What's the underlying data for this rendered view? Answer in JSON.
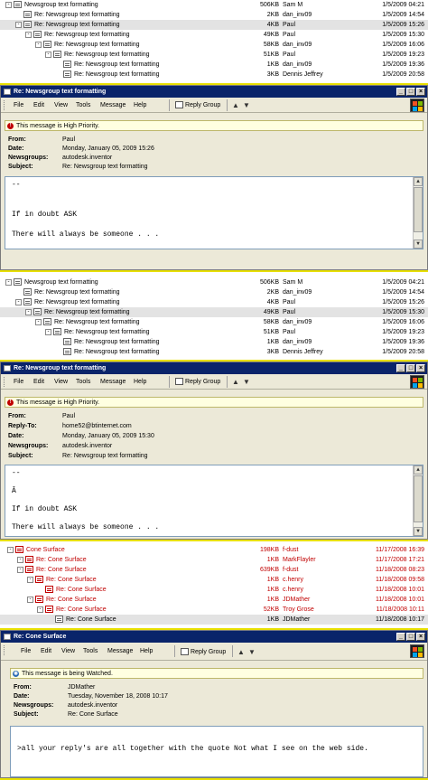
{
  "thread1": {
    "rows": [
      {
        "indent": 0,
        "subject": "Newsgroup text formatting",
        "size": "506KB",
        "from": "Sam M",
        "date": "1/5/2009 04:21",
        "exp": "-"
      },
      {
        "indent": 1,
        "subject": "Re: Newsgroup text formatting",
        "size": "2KB",
        "from": "dan_inv09",
        "date": "1/5/2009 14:54",
        "exp": ""
      },
      {
        "indent": 1,
        "subject": "Re: Newsgroup text formatting",
        "size": "4KB",
        "from": "Paul",
        "date": "1/5/2009 15:26",
        "exp": "-",
        "selected": true
      },
      {
        "indent": 2,
        "subject": "Re: Newsgroup text formatting",
        "size": "49KB",
        "from": "Paul",
        "date": "1/5/2009 15:30",
        "exp": "-"
      },
      {
        "indent": 3,
        "subject": "Re: Newsgroup text formatting",
        "size": "58KB",
        "from": "dan_inv09",
        "date": "1/5/2009 16:06",
        "exp": "-"
      },
      {
        "indent": 4,
        "subject": "Re: Newsgroup text formatting",
        "size": "51KB",
        "from": "Paul",
        "date": "1/5/2009 19:23",
        "exp": "-"
      },
      {
        "indent": 5,
        "subject": "Re: Newsgroup text formatting",
        "size": "1KB",
        "from": "dan_inv09",
        "date": "1/5/2009 19:36",
        "exp": ""
      },
      {
        "indent": 5,
        "subject": "Re: Newsgroup text formatting",
        "size": "3KB",
        "from": "Dennis Jeffrey",
        "date": "1/5/2009 20:58",
        "exp": ""
      }
    ]
  },
  "window1": {
    "title": "Re: Newsgroup text formatting",
    "menu": [
      "File",
      "Edit",
      "View",
      "Tools",
      "Message",
      "Help"
    ],
    "reply_group": "Reply Group",
    "banner": "This message is High Priority.",
    "headers": [
      {
        "k": "From:",
        "v": "Paul"
      },
      {
        "k": "Date:",
        "v": "Monday, January 05, 2009 15:26"
      },
      {
        "k": "Newsgroups:",
        "v": "autodesk.inventor"
      },
      {
        "k": "Subject:",
        "v": "Re: Newsgroup text formatting"
      }
    ],
    "body": [
      "--",
      "",
      "",
      "If in doubt ASK",
      "",
      "There will always be someone . . ."
    ]
  },
  "thread2": {
    "rows": [
      {
        "indent": 0,
        "subject": "Newsgroup text formatting",
        "size": "506KB",
        "from": "Sam M",
        "date": "1/5/2009 04:21",
        "exp": "-"
      },
      {
        "indent": 1,
        "subject": "Re: Newsgroup text formatting",
        "size": "2KB",
        "from": "dan_inv09",
        "date": "1/5/2009 14:54",
        "exp": ""
      },
      {
        "indent": 1,
        "subject": "Re: Newsgroup text formatting",
        "size": "4KB",
        "from": "Paul",
        "date": "1/5/2009 15:26",
        "exp": "-"
      },
      {
        "indent": 2,
        "subject": "Re: Newsgroup text formatting",
        "size": "49KB",
        "from": "Paul",
        "date": "1/5/2009 15:30",
        "exp": "-",
        "selected": true
      },
      {
        "indent": 3,
        "subject": "Re: Newsgroup text formatting",
        "size": "58KB",
        "from": "dan_inv09",
        "date": "1/5/2009 16:06",
        "exp": "-"
      },
      {
        "indent": 4,
        "subject": "Re: Newsgroup text formatting",
        "size": "51KB",
        "from": "Paul",
        "date": "1/5/2009 19:23",
        "exp": "-"
      },
      {
        "indent": 5,
        "subject": "Re: Newsgroup text formatting",
        "size": "1KB",
        "from": "dan_inv09",
        "date": "1/5/2009 19:36",
        "exp": ""
      },
      {
        "indent": 5,
        "subject": "Re: Newsgroup text formatting",
        "size": "3KB",
        "from": "Dennis Jeffrey",
        "date": "1/5/2009 20:58",
        "exp": ""
      }
    ]
  },
  "window2": {
    "title": "Re: Newsgroup text formatting",
    "menu": [
      "File",
      "Edit",
      "View",
      "Tools",
      "Message",
      "Help"
    ],
    "reply_group": "Reply Group",
    "banner": "This message is High Priority.",
    "headers": [
      {
        "k": "From:",
        "v": "Paul"
      },
      {
        "k": "Reply-To:",
        "v": "home52@btinternet.com"
      },
      {
        "k": "Date:",
        "v": "Monday, January 05, 2009 15:30"
      },
      {
        "k": "Newsgroups:",
        "v": "autodesk.inventor"
      },
      {
        "k": "Subject:",
        "v": "Re: Newsgroup text formatting"
      }
    ],
    "body": [
      "--",
      "",
      "Â",
      "",
      "If in doubt ASK",
      "",
      "There will always be someone . . ."
    ]
  },
  "thread3": {
    "rows": [
      {
        "indent": 0,
        "subject": "Cone Surface",
        "size": "198KB",
        "from": "f-dust",
        "date": "11/17/2008 16:39",
        "exp": "-"
      },
      {
        "indent": 1,
        "subject": "Re: Cone Surface",
        "size": "1KB",
        "from": "MarkFlayler",
        "date": "11/17/2008 17:21",
        "exp": "-"
      },
      {
        "indent": 1,
        "subject": "Re: Cone Surface",
        "size": "639KB",
        "from": "f-dust",
        "date": "11/18/2008 08:23",
        "exp": "-"
      },
      {
        "indent": 2,
        "subject": "Re: Cone Surface",
        "size": "1KB",
        "from": "c.henry",
        "date": "11/18/2008 09:58",
        "exp": "-"
      },
      {
        "indent": 3,
        "subject": "Re: Cone Surface",
        "size": "1KB",
        "from": "c.henry",
        "date": "11/18/2008 10:01",
        "exp": ""
      },
      {
        "indent": 2,
        "subject": "Re: Cone Surface",
        "size": "1KB",
        "from": "JDMather",
        "date": "11/18/2008 10:01",
        "exp": "-"
      },
      {
        "indent": 3,
        "subject": "Re: Cone Surface",
        "size": "52KB",
        "from": "Troy Grose",
        "date": "11/18/2008 10:11",
        "exp": "-"
      },
      {
        "indent": 4,
        "subject": "Re: Cone Surface",
        "size": "1KB",
        "from": "JDMather",
        "date": "11/18/2008 10:17",
        "exp": "",
        "selected": true,
        "black": true
      }
    ]
  },
  "window3": {
    "title": "Re: Cone Surface",
    "menu": [
      "File",
      "Edit",
      "View",
      "Tools",
      "Message",
      "Help"
    ],
    "reply_group": "Reply Group",
    "banner": "This message is being Watched.",
    "headers": [
      {
        "k": "From:",
        "v": "JDMather"
      },
      {
        "k": "Date:",
        "v": "Tuesday, November 18, 2008 10:17"
      },
      {
        "k": "Newsgroups:",
        "v": "autodesk.inventor"
      },
      {
        "k": "Subject:",
        "v": "Re: Cone Surface"
      }
    ],
    "body": [
      ">all your reply's are all together with the quote Not what I see on the web side."
    ]
  },
  "colors": {
    "title_bg": "#0a246a",
    "watched_red": "#c00000",
    "priority_red": "#c00000"
  },
  "icons": {
    "message": "message-icon",
    "expand": "collapse-toggle-icon",
    "priority": "high-priority-icon",
    "watch": "watch-icon",
    "reply": "reply-group-icon"
  }
}
